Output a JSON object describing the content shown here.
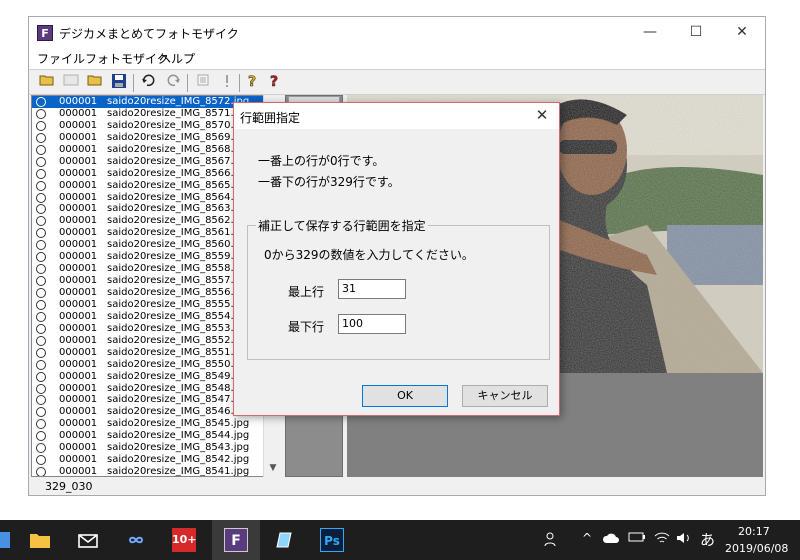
{
  "window": {
    "title": "デジカメまとめてフォトモザイク",
    "icon_letter": "F",
    "minimize": "—",
    "maximize": "☐",
    "close": "✕"
  },
  "menu": [
    "ファイル",
    "フォトモザイク",
    "ヘルプ"
  ],
  "file_list": [
    {
      "num": "000001",
      "name": "saido20resize_IMG_8572.jpg",
      "selected": true
    },
    {
      "num": "000001",
      "name": "saido20resize_IMG_8571.jpg"
    },
    {
      "num": "000001",
      "name": "saido20resize_IMG_8570.jpg"
    },
    {
      "num": "000001",
      "name": "saido20resize_IMG_8569.jpg"
    },
    {
      "num": "000001",
      "name": "saido20resize_IMG_8568.jpg"
    },
    {
      "num": "000001",
      "name": "saido20resize_IMG_8567.jpg"
    },
    {
      "num": "000001",
      "name": "saido20resize_IMG_8566.jpg"
    },
    {
      "num": "000001",
      "name": "saido20resize_IMG_8565.jpg"
    },
    {
      "num": "000001",
      "name": "saido20resize_IMG_8564.jpg"
    },
    {
      "num": "000001",
      "name": "saido20resize_IMG_8563.jpg"
    },
    {
      "num": "000001",
      "name": "saido20resize_IMG_8562.jpg"
    },
    {
      "num": "000001",
      "name": "saido20resize_IMG_8561.jpg"
    },
    {
      "num": "000001",
      "name": "saido20resize_IMG_8560.jpg"
    },
    {
      "num": "000001",
      "name": "saido20resize_IMG_8559.jpg"
    },
    {
      "num": "000001",
      "name": "saido20resize_IMG_8558.jpg"
    },
    {
      "num": "000001",
      "name": "saido20resize_IMG_8557.jpg"
    },
    {
      "num": "000001",
      "name": "saido20resize_IMG_8556.jpg"
    },
    {
      "num": "000001",
      "name": "saido20resize_IMG_8555.jpg"
    },
    {
      "num": "000001",
      "name": "saido20resize_IMG_8554.jpg"
    },
    {
      "num": "000001",
      "name": "saido20resize_IMG_8553.jpg"
    },
    {
      "num": "000001",
      "name": "saido20resize_IMG_8552.jpg"
    },
    {
      "num": "000001",
      "name": "saido20resize_IMG_8551.jpg"
    },
    {
      "num": "000001",
      "name": "saido20resize_IMG_8550.jpg"
    },
    {
      "num": "000001",
      "name": "saido20resize_IMG_8549.jpg"
    },
    {
      "num": "000001",
      "name": "saido20resize_IMG_8548.jpg"
    },
    {
      "num": "000001",
      "name": "saido20resize_IMG_8547.jpg"
    },
    {
      "num": "000001",
      "name": "saido20resize_IMG_8546.jpg"
    },
    {
      "num": "000001",
      "name": "saido20resize_IMG_8545.jpg"
    },
    {
      "num": "000001",
      "name": "saido20resize_IMG_8544.jpg"
    },
    {
      "num": "000001",
      "name": "saido20resize_IMG_8543.jpg"
    },
    {
      "num": "000001",
      "name": "saido20resize_IMG_8542.jpg"
    },
    {
      "num": "000001",
      "name": "saido20resize_IMG_8541.jpg"
    }
  ],
  "status_text": "329_030",
  "dialog": {
    "title": "行範囲指定",
    "close": "✕",
    "line1": "一番上の行が0行です。",
    "line2": "一番下の行が329行です。",
    "group_label": "補正して保存する行範囲を指定",
    "instruction": "0から329の数値を入力してください。",
    "top_label": "最上行",
    "top_value": "31",
    "bottom_label": "最下行",
    "bottom_value": "100",
    "ok": "OK",
    "cancel": "キャンセル"
  },
  "taskbar": {
    "time": "20:17",
    "date": "2019/06/08",
    "ime": "あ",
    "badge": "10+"
  },
  "colors": {
    "selection": "#0a64c8",
    "dialog_border": "#d06b74",
    "taskbar": "#1e1e1e"
  }
}
